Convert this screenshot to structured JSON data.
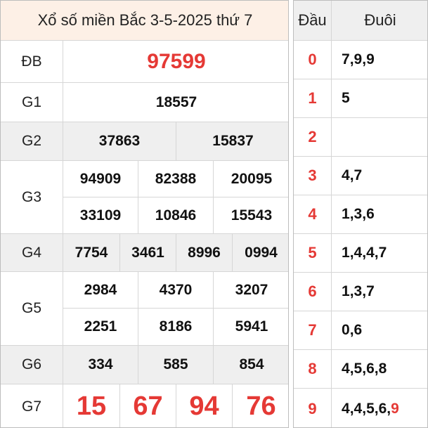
{
  "title": "Xổ số miền Bắc 3-5-2025 thứ 7",
  "prizes": {
    "db": {
      "label": "ĐB",
      "numbers": [
        "97599"
      ]
    },
    "g1": {
      "label": "G1",
      "numbers": [
        "18557"
      ]
    },
    "g2": {
      "label": "G2",
      "numbers": [
        "37863",
        "15837"
      ]
    },
    "g3": {
      "label": "G3",
      "numbers": [
        "94909",
        "82388",
        "20095",
        "33109",
        "10846",
        "15543"
      ]
    },
    "g4": {
      "label": "G4",
      "numbers": [
        "7754",
        "3461",
        "8996",
        "0994"
      ]
    },
    "g5": {
      "label": "G5",
      "numbers": [
        "2984",
        "4370",
        "3207",
        "2251",
        "8186",
        "5941"
      ]
    },
    "g6": {
      "label": "G6",
      "numbers": [
        "334",
        "585",
        "854"
      ]
    },
    "g7": {
      "label": "G7",
      "numbers": [
        "15",
        "67",
        "94",
        "76"
      ]
    }
  },
  "loto": {
    "header_dau": "Đầu",
    "header_duoi": "Đuôi",
    "rows": [
      {
        "dau": "0",
        "tails": [
          "7",
          "9",
          "9"
        ],
        "hl": []
      },
      {
        "dau": "1",
        "tails": [
          "5"
        ],
        "hl": []
      },
      {
        "dau": "2",
        "tails": [],
        "hl": []
      },
      {
        "dau": "3",
        "tails": [
          "4",
          "7"
        ],
        "hl": []
      },
      {
        "dau": "4",
        "tails": [
          "1",
          "3",
          "6"
        ],
        "hl": []
      },
      {
        "dau": "5",
        "tails": [
          "1",
          "4",
          "4",
          "7"
        ],
        "hl": []
      },
      {
        "dau": "6",
        "tails": [
          "1",
          "3",
          "7"
        ],
        "hl": []
      },
      {
        "dau": "7",
        "tails": [
          "0",
          "6"
        ],
        "hl": []
      },
      {
        "dau": "8",
        "tails": [
          "4",
          "5",
          "6",
          "8"
        ],
        "hl": []
      },
      {
        "dau": "9",
        "tails": [
          "4",
          "4",
          "5",
          "6",
          "9"
        ],
        "hl": [
          4
        ]
      }
    ]
  },
  "colors": {
    "accent_red": "#e53935",
    "header_bg": "#fdf0e6",
    "shaded_row": "#efefef"
  }
}
